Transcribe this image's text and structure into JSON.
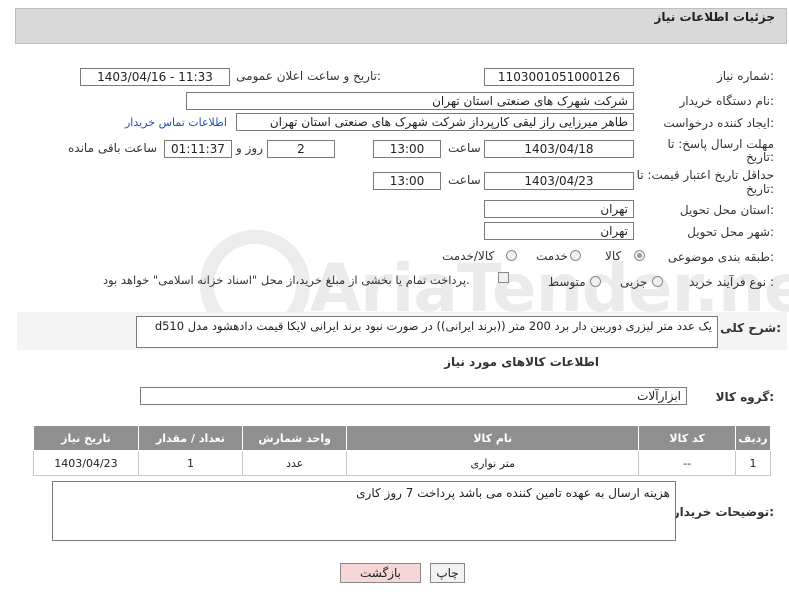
{
  "header": {
    "title": "جزئیات اطلاعات نیاز"
  },
  "fields": {
    "need_number_label": "شماره نیاز:",
    "need_number": "1103001051000126",
    "announce_label": "تاریخ و ساعت اعلان عمومی:",
    "announce_value": "1403/04/16 - 11:33",
    "buyer_label": "نام دستگاه خریدار:",
    "buyer_value": "شرکت شهرک های صنعتی استان تهران",
    "creator_label": "ایجاد کننده درخواست:",
    "creator_value": "طاهر  میرزایی راز لیقی کارپرداز شرکت شهرک های صنعتی استان تهران",
    "contact_link": "اطلاعات تماس خریدار",
    "deadline_label_line1": "مهلت ارسال پاسخ: تا",
    "deadline_label_line2": "تاریخ:",
    "deadline_date": "1403/04/18",
    "time_label": "ساعت",
    "deadline_time": "13:00",
    "days_count": "2",
    "days_label": "روز و",
    "remaining_time": "01:11:37",
    "remaining_label": "ساعت باقی مانده",
    "validity_label_line1": "حداقل تاریخ اعتبار قیمت: تا",
    "validity_label_line2": "تاریخ:",
    "validity_date": "1403/04/23",
    "validity_time_label": "ساعت",
    "validity_time": "13:00",
    "province_label": "استان محل تحویل:",
    "province_value": "تهران",
    "city_label": "شهر محل تحویل:",
    "city_value": "تهران",
    "category_label": "طبقه بندی موضوعی:",
    "category_options": [
      "کالا",
      "خدمت",
      "کالا/خدمت"
    ],
    "process_label": "نوع فرآیند خرید :",
    "process_options": [
      "جزیی",
      "متوسط"
    ],
    "payment_note": "پرداخت تمام یا بخشی از مبلغ خرید،از محل \"اسناد خزانه اسلامی\" خواهد بود."
  },
  "description": {
    "label": "شرح کلی نیاز:",
    "text": "یک عدد متر لیزری دوربین دار  برد 200 متر  ((برند ایرانی)) در صورت نبود برند ایرانی لایکا قیمت دادهشود مدل d510"
  },
  "goods": {
    "section_title": "اطلاعات کالاهای مورد نیاز",
    "group_label": "گروه کالا:",
    "group_value": "ابزارآلات",
    "columns": [
      "ردیف",
      "کد کالا",
      "نام کالا",
      "واحد شمارش",
      "تعداد / مقدار",
      "تاریخ نیاز"
    ],
    "rows": [
      {
        "row": "1",
        "code": "--",
        "name": "متر نواری",
        "unit": "عدد",
        "qty": "1",
        "date": "1403/04/23"
      }
    ]
  },
  "buyer_notes": {
    "label": "توضیحات خریدار:",
    "text": "هزینه ارسال به عهده تامین کننده می باشد    پرداخت 7 روز کاری"
  },
  "buttons": {
    "print": "چاپ",
    "back": "بازگشت"
  },
  "watermark": {
    "text": "AriaTender.neT"
  },
  "colors": {
    "header_bg": "#d9d9d9",
    "table_header_bg": "#8f8f8f",
    "link": "#1f4fb6",
    "back_button_bg": "#f6d7d7"
  }
}
